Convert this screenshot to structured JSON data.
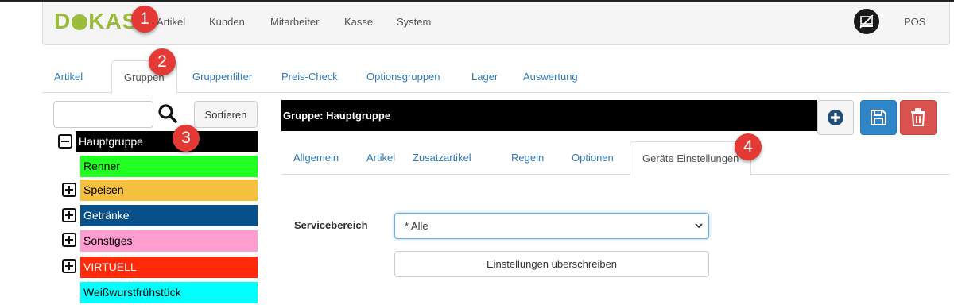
{
  "navbar": {
    "logo_text": "DKAS",
    "items": [
      "Artikel",
      "Kunden",
      "Mitarbeiter",
      "Kasse",
      "System"
    ],
    "pos_label": "POS",
    "pos_icon": "pos-terminal-icon"
  },
  "badges": [
    "1",
    "2",
    "3",
    "4"
  ],
  "main_tabs": {
    "items": [
      "Artikel",
      "Gruppen",
      "Gruppenfilter",
      "Preis-Check",
      "Optionsgruppen",
      "Lager",
      "Auswertung"
    ],
    "active": "Gruppen"
  },
  "sidebar": {
    "search_placeholder": "",
    "sort_label": "Sortieren",
    "groups": [
      {
        "label": "Hauptgruppe",
        "color": "#000000",
        "text_color": "#ffffff",
        "toggle": "minus"
      },
      {
        "label": "Renner",
        "color": "#22ff22",
        "text_color": "#000000",
        "toggle": "none"
      },
      {
        "label": "Speisen",
        "color": "#f5c040",
        "text_color": "#000000",
        "toggle": "plus"
      },
      {
        "label": "Getränke",
        "color": "#08508a",
        "text_color": "#ffffff",
        "toggle": "plus"
      },
      {
        "label": "Sonstiges",
        "color": "#ff9cd0",
        "text_color": "#000000",
        "toggle": "plus"
      },
      {
        "label": "VIRTUELL",
        "color": "#ff2a0a",
        "text_color": "#ffffff",
        "toggle": "plus"
      },
      {
        "label": "Weißwurstfrühstück",
        "color": "#00ffff",
        "text_color": "#000000",
        "toggle": "none"
      }
    ]
  },
  "group_panel": {
    "header": "Gruppe: Hauptgruppe",
    "tabs": [
      "Allgemein",
      "Artikel",
      "Zusatzartikel",
      "Regeln",
      "Optionen",
      "Geräte Einstellungen"
    ],
    "active_tab": "Geräte Einstellungen",
    "service_label": "Servicebereich",
    "service_value": "* Alle",
    "overwrite_label": "Einstellungen überschreiben"
  },
  "colors": {
    "link": "#337ab7",
    "badge": "#e53935",
    "logo": "#9bbb3c",
    "save": "#2e86c8",
    "delete": "#d9534f"
  }
}
